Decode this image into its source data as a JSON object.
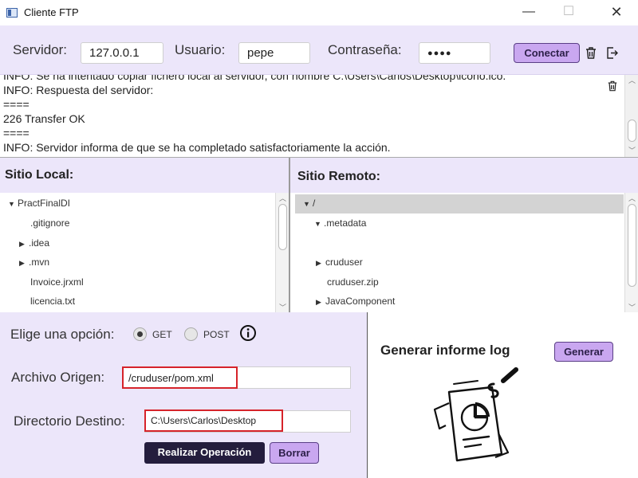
{
  "window": {
    "title": "Cliente FTP",
    "minimize": "—",
    "maximize": "☐",
    "close": "✕"
  },
  "connection": {
    "server_label": "Servidor:",
    "server_value": "127.0.0.1",
    "user_label": "Usuario:",
    "user_value": "pepe",
    "password_label": "Contraseña:",
    "password_value": "●●●●",
    "connect_button": "Conectar"
  },
  "log": {
    "lines": [
      "INFO: Se ha intentado copiar fichero local al servidor, con nombre C:\\Users\\Carlos\\Desktop\\icono.ico.",
      "INFO: Respuesta del servidor:",
      "====",
      " 226 Transfer OK",
      " ====",
      "INFO: Servidor informa de que se ha completado satisfactoriamente la acción."
    ]
  },
  "local": {
    "title": "Sitio Local:",
    "items": [
      {
        "label": "PractFinalDI",
        "arrow": "▼"
      },
      {
        "label": ".gitignore",
        "arrow": ""
      },
      {
        "label": ".idea",
        "arrow": "▶"
      },
      {
        "label": ".mvn",
        "arrow": "▶"
      },
      {
        "label": "Invoice.jrxml",
        "arrow": ""
      },
      {
        "label": "licencia.txt",
        "arrow": ""
      }
    ]
  },
  "remote": {
    "title": "Sitio Remoto:",
    "items": [
      {
        "label": "/",
        "arrow": "▼"
      },
      {
        "label": ".metadata",
        "arrow": "▼"
      },
      {
        "label": "",
        "arrow": ""
      },
      {
        "label": "cruduser",
        "arrow": "▶"
      },
      {
        "label": "cruduser.zip",
        "arrow": ""
      },
      {
        "label": "JavaComponent",
        "arrow": "▶"
      }
    ]
  },
  "operation": {
    "option_label": "Elige una opción:",
    "get_label": "GET",
    "post_label": "POST",
    "get_selected": true,
    "info_icon": "info-icon",
    "origin_label": "Archivo Origen:",
    "origin_value": "/cruduser/pom.xml",
    "dest_label": "Directorio Destino:",
    "dest_value": "C:\\Users\\Carlos\\Desktop",
    "run_button": "Realizar Operación",
    "clear_button": "Borrar"
  },
  "report": {
    "title": "Generar informe log",
    "generate_button": "Generar",
    "illustration": "report-document-illustration"
  },
  "colors": {
    "accent_bg": "#ece6fa",
    "button_purple": "#c9a7f0",
    "button_dark": "#241d3d",
    "highlight_red": "#d6232a"
  }
}
